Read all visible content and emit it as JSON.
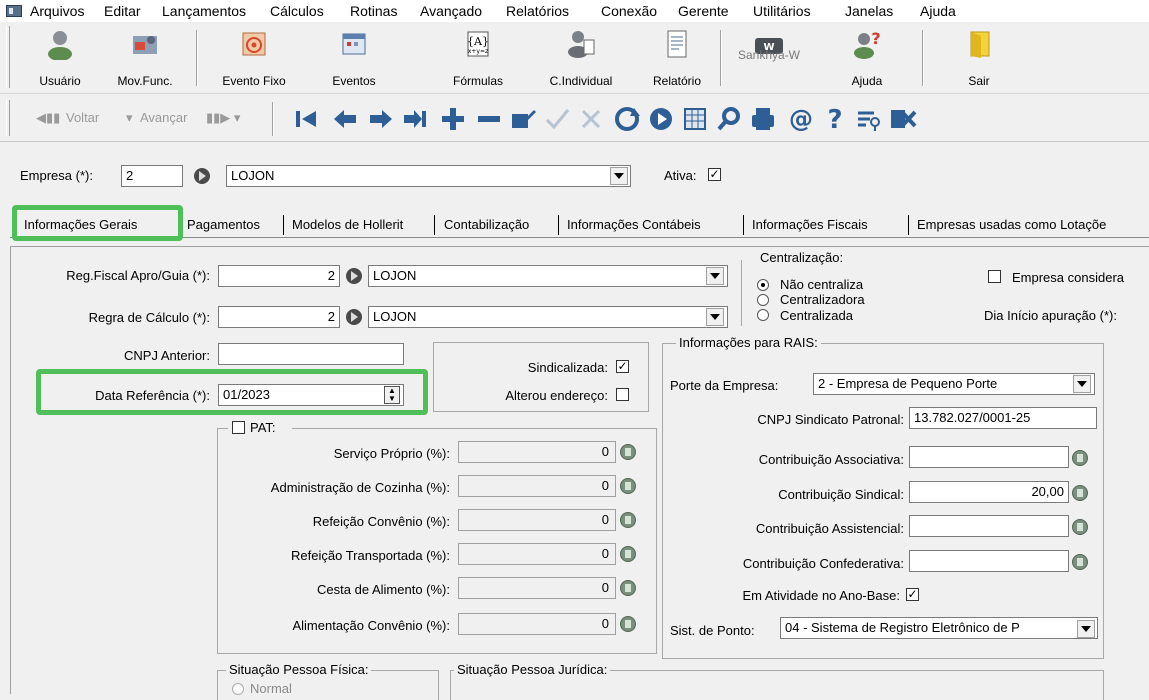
{
  "menu": [
    "Arquivos",
    "Editar",
    "Lançamentos",
    "Cálculos",
    "Rotinas",
    "Avançado",
    "Relatórios",
    "Conexão",
    "Gerente",
    "Utilitários",
    "Janelas",
    "Ajuda"
  ],
  "toolbar": {
    "usuario": "Usuário",
    "movfunc": "Mov.Func.",
    "evento_fixo": "Evento Fixo",
    "eventos": "Eventos",
    "formulas": "Fórmulas",
    "cindividual": "C.Individual",
    "relatorio": "Relatório",
    "sankhya": "Sankhya-W",
    "ajuda": "Ajuda",
    "sair": "Sair"
  },
  "nav": {
    "voltar": "Voltar",
    "avancar": "Avançar"
  },
  "header": {
    "empresa_label": "Empresa (*):",
    "empresa_code": "2",
    "empresa_name": "LOJON",
    "ativa_label": "Ativa:"
  },
  "tabs": [
    "Informações Gerais",
    "Pagamentos",
    "Modelos de Hollerit",
    "Contabilização",
    "Informações Contábeis",
    "Informações Fiscais",
    "Empresas usadas como Lotaçõe"
  ],
  "geral": {
    "reg_fiscal_label": "Reg.Fiscal Apro/Guia (*):",
    "reg_fiscal_code": "2",
    "reg_fiscal_name": "LOJON",
    "regra_calc_label": "Regra de Cálculo (*):",
    "regra_calc_code": "2",
    "regra_calc_name": "LOJON",
    "cnpj_anterior_label": "CNPJ Anterior:",
    "cnpj_anterior_value": "",
    "data_ref_label": "Data Referência (*):",
    "data_ref_value": "01/2023",
    "sindicalizada_label": "Sindicalizada:",
    "alterou_endereco_label": "Alterou endereço:",
    "empresa_considera_label": "Empresa considera",
    "dia_inicio_label": "Dia Início apuração (*):"
  },
  "centralizacao": {
    "title": "Centralização:",
    "options": [
      "Não centraliza",
      "Centralizadora",
      "Centralizada"
    ]
  },
  "pat": {
    "title": "PAT:",
    "rows": [
      {
        "label": "Serviço Próprio (%):",
        "value": "0"
      },
      {
        "label": "Administração de Cozinha (%):",
        "value": "0"
      },
      {
        "label": "Refeição Convênio (%):",
        "value": "0"
      },
      {
        "label": "Refeição Transportada (%):",
        "value": "0"
      },
      {
        "label": "Cesta de Alimento (%):",
        "value": "0"
      },
      {
        "label": "Alimentação Convênio (%):",
        "value": "0"
      }
    ]
  },
  "rais": {
    "title": "Informações para RAIS:",
    "porte_label": "Porte da Empresa:",
    "porte_value": "2 - Empresa de Pequeno Porte",
    "cnpj_sind_label": "CNPJ Sindicato Patronal:",
    "cnpj_sind_value": "13.782.027/0001-25",
    "contrib_assoc_label": "Contribuição Associativa:",
    "contrib_assoc_value": "",
    "contrib_sind_label": "Contribuição Sindical:",
    "contrib_sind_value": "20,00",
    "contrib_assist_label": "Contribuição Assistencial:",
    "contrib_assist_value": "",
    "contrib_conf_label": "Contribuição Confederativa:",
    "contrib_conf_value": "",
    "em_atividade_label": "Em Atividade no Ano-Base:",
    "sist_ponto_label": "Sist. de Ponto:",
    "sist_ponto_value": "04 - Sistema de Registro Eletrônico de P"
  },
  "situacao": {
    "pf_title": "Situação Pessoa Física:",
    "pj_title": "Situação Pessoa Jurídica:",
    "pf_normal": "Normal"
  },
  "colors": {
    "highlight": "#4fbf5a"
  }
}
